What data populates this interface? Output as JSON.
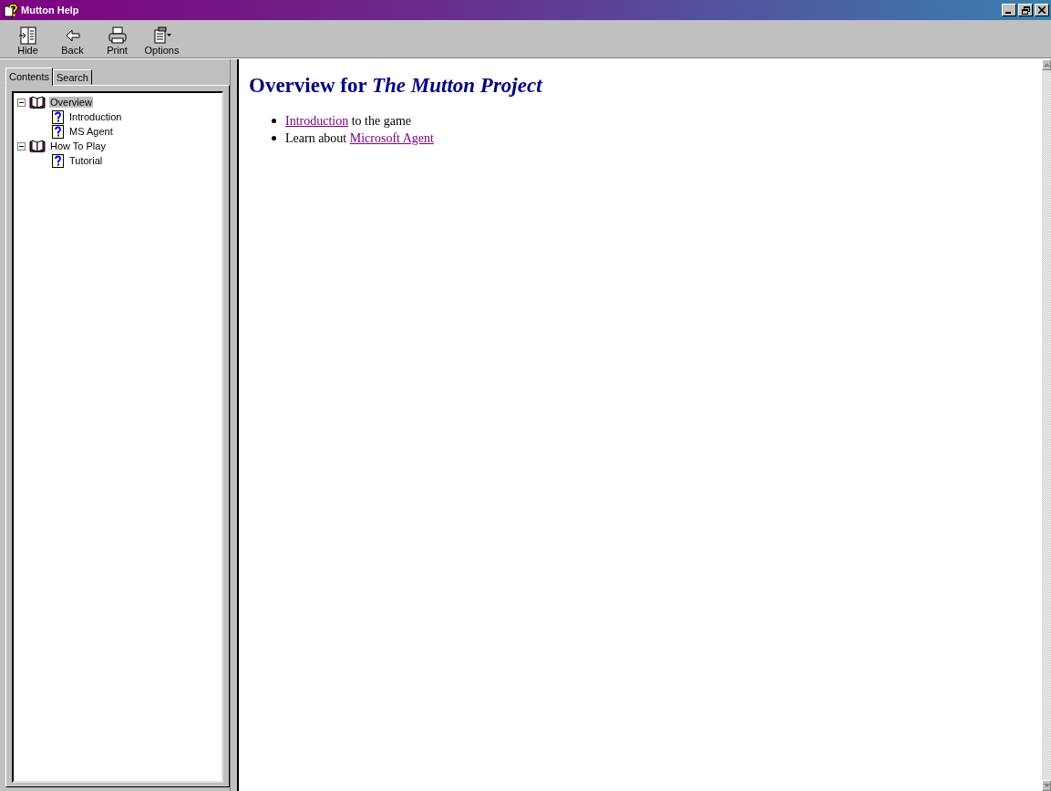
{
  "window": {
    "title": "Mutton Help"
  },
  "toolbar": [
    {
      "label": "Hide",
      "kind": "hide"
    },
    {
      "label": "Back",
      "kind": "back"
    },
    {
      "label": "Print",
      "kind": "print"
    },
    {
      "label": "Options",
      "kind": "options"
    }
  ],
  "tabs": [
    {
      "label": "Contents",
      "selected": true
    },
    {
      "label": "Search",
      "selected": false
    }
  ],
  "tree": [
    {
      "label": "Overview",
      "kind": "book",
      "expanded": true,
      "selected": true,
      "children": [
        {
          "label": "Introduction",
          "kind": "topic",
          "selected": false
        },
        {
          "label": "MS Agent",
          "kind": "topic",
          "selected": false
        }
      ]
    },
    {
      "label": "How To Play",
      "kind": "book",
      "expanded": true,
      "selected": false,
      "children": [
        {
          "label": "Tutorial",
          "kind": "topic",
          "selected": false
        }
      ]
    }
  ],
  "content": {
    "heading": "Overview for *The Mutton Project*",
    "bullets": [
      [
        {
          "kind": "link",
          "text": "Introduction"
        },
        {
          "kind": "text",
          "text": "to the game"
        }
      ],
      [
        {
          "kind": "text",
          "text": "Learn about"
        },
        {
          "kind": "link",
          "text": "Microsoft Agent"
        }
      ]
    ]
  }
}
